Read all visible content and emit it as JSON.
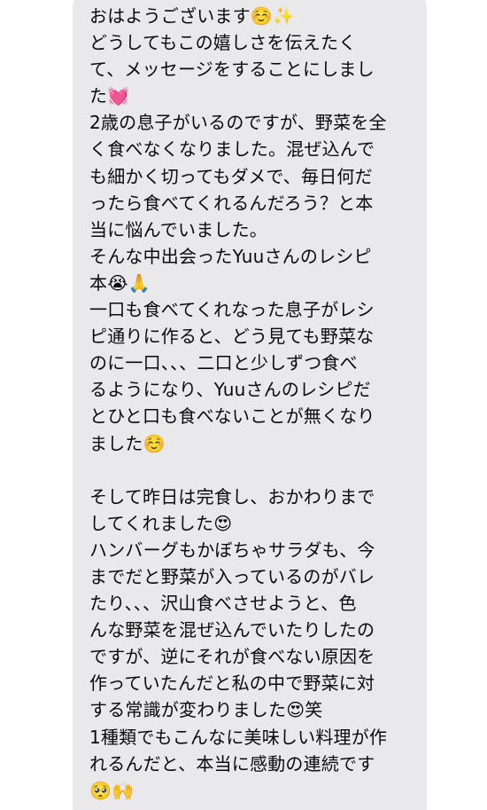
{
  "message": {
    "lines": [
      "おはようございます☺️✨",
      "どうしてもこの嬉しさを伝えたく",
      "て、メッセージをすることにしまし",
      "た💓",
      "2歳の息子がいるのですが、野菜を全",
      "く食べなくなりました。混ぜ込んで",
      "も細かく切ってもダメで、毎日何だ",
      "ったら食べてくれるんだろう？と本",
      "当に悩んでいました。",
      "そんな中出会ったYuuさんのレシピ",
      "本😭🙏",
      "一口も食べてくれなった息子がレシ",
      "ピ通りに作ると、どう見ても野菜な",
      "のに一口、、、二口と少しずつ食べ",
      "るようになり、Yuuさんのレシピだ",
      "とひと口も食べないことが無くなり",
      "ました☺️",
      "",
      "そして昨日は完食し、おかわりまで",
      "してくれました😍",
      "ハンバーグもかぼちゃサラダも、今",
      "までだと野菜が入っているのがバレ",
      "たり、、、沢山食べさせようと、色",
      "んな野菜を混ぜ込んでいたりしたの",
      "ですが、逆にそれが食べない原因を",
      "作っていたんだと私の中で野菜に対",
      "する常識が変わりました😍笑",
      "1種類でもこんなに美味しい料理が作",
      "れるんだと、本当に感動の連続です",
      "🥺🙌"
    ]
  },
  "colors": {
    "bubble": "#e9e9eb",
    "text": "#0b0b0b",
    "background": "#ffffff"
  }
}
